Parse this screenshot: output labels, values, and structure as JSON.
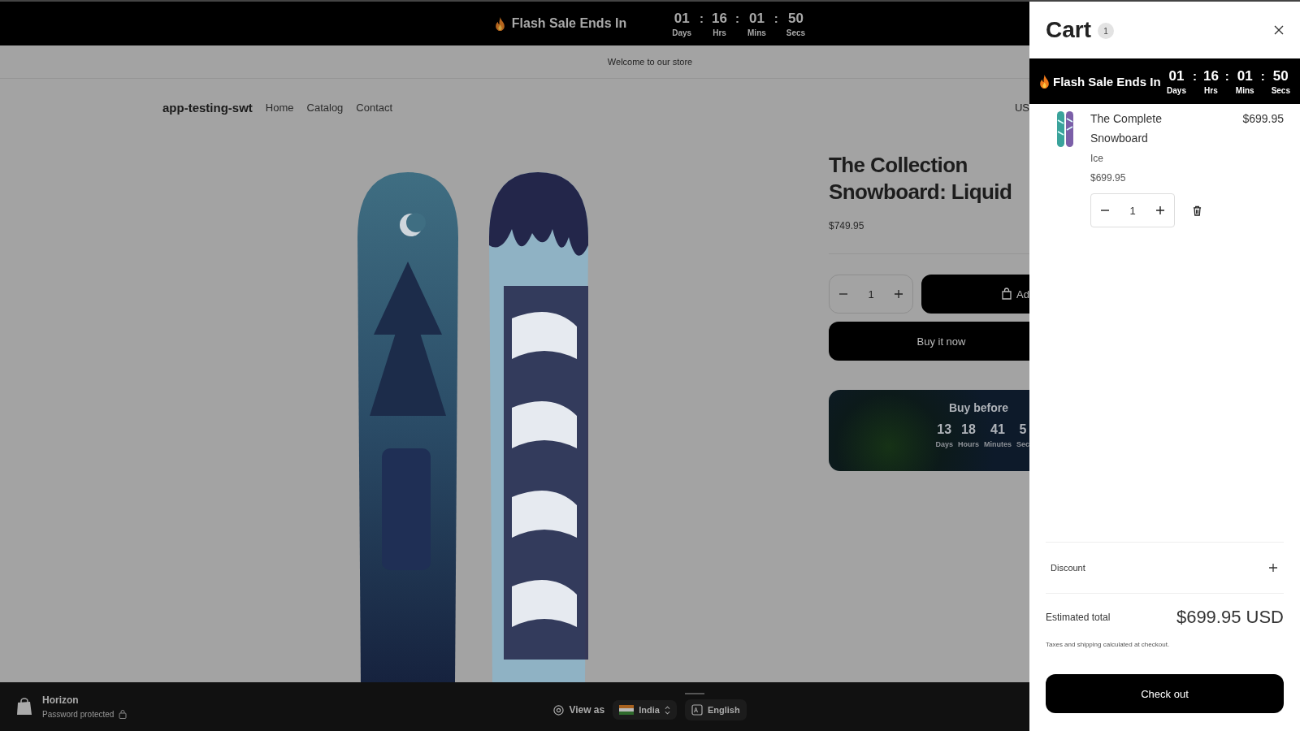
{
  "flash_bar": {
    "title": "Flash Sale Ends In",
    "separator": ":",
    "units": [
      {
        "value": "01",
        "label": "Days"
      },
      {
        "value": "16",
        "label": "Hrs"
      },
      {
        "value": "01",
        "label": "Mins"
      },
      {
        "value": "50",
        "label": "Secs"
      }
    ]
  },
  "announcement": "Welcome to our store",
  "header": {
    "store_name": "app-testing-swt",
    "nav": [
      {
        "label": "Home"
      },
      {
        "label": "Catalog"
      },
      {
        "label": "Contact"
      }
    ],
    "currency": "US"
  },
  "product": {
    "title": "The Collection Snowboard: Liquid",
    "price": "$749.95",
    "quantity": "1",
    "add_button": "Ad",
    "buy_button": "Buy it now",
    "countdown": {
      "title": "Buy before",
      "units": [
        {
          "value": "13",
          "label": "Days"
        },
        {
          "value": "18",
          "label": "Hours"
        },
        {
          "value": "41",
          "label": "Minutes"
        },
        {
          "value": "5",
          "label": "Sec"
        }
      ]
    }
  },
  "preview_bar": {
    "theme": "Horizon",
    "status": "Password protected",
    "view_as": "View as",
    "country": "India",
    "language": "English"
  },
  "cart": {
    "title": "Cart",
    "count": "1",
    "flash_bar": {
      "title": "Flash Sale Ends In",
      "separator": ":",
      "units": [
        {
          "value": "01",
          "label": "Days"
        },
        {
          "value": "16",
          "label": "Hrs"
        },
        {
          "value": "01",
          "label": "Mins"
        },
        {
          "value": "50",
          "label": "Secs"
        }
      ]
    },
    "items": [
      {
        "name": "The Complete Snowboard",
        "variant": "Ice",
        "unit_price": "$699.95",
        "line_price": "$699.95",
        "quantity": "1"
      }
    ],
    "discount_label": "Discount",
    "total_label": "Estimated total",
    "total": "$699.95 USD",
    "note": "Taxes and shipping calculated at checkout.",
    "checkout_button": "Check out"
  }
}
